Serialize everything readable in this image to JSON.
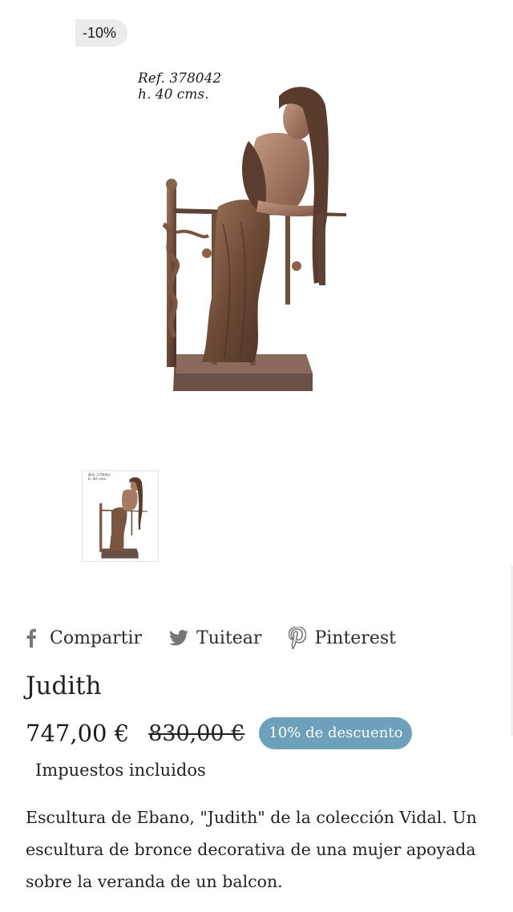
{
  "badge": {
    "discount": "-10%"
  },
  "image": {
    "ref_line1": "Ref. 378042",
    "ref_line2": "h. 40 cms.",
    "alt": "Judith"
  },
  "thumbnail": {
    "ref_line1": "Ref. 378042",
    "ref_line2": "h. 40 cms."
  },
  "share": {
    "facebook_label": "Compartir",
    "twitter_label": "Tuitear",
    "pinterest_label": "Pinterest"
  },
  "product": {
    "title": "Judith",
    "price": "747,00 €",
    "compare_price": "830,00 €",
    "discount_label": "10% de descuento",
    "tax_note": "Impuestos incluidos",
    "description": {
      "part1": "Escultura de Ebano, \"Judith\" de la colección Vidal. Un ",
      "part2": "escultura de bronce decorativa",
      "part3": " de una mujer apoyada sobre la veranda de un balcon."
    }
  },
  "colors": {
    "badge_bg": "#ebebeb",
    "discount_pill": "#6da0bb",
    "bronze": "#7a5540"
  }
}
